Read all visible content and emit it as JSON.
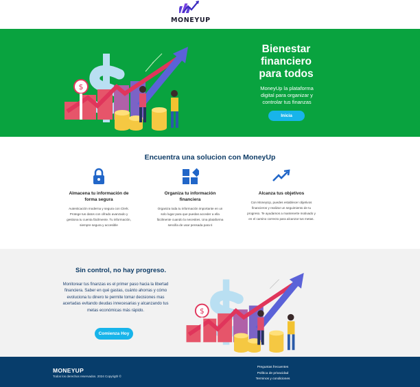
{
  "header": {
    "brand": "MONEYUP",
    "logo_icon": "moneyup-logo-icon"
  },
  "hero": {
    "title": "Bienestar financiero para todos",
    "subtitle": "MoneyUp la plataforma digital para organizar y controlar tus finanzas",
    "cta_label": "Inicia",
    "illustration": "finance-growth-illustration"
  },
  "features": {
    "title": "Encuentra una solucion con MoneyUp",
    "items": [
      {
        "icon": "lock-icon",
        "title": "Almacena tu información de forma segura",
        "text": "Autenticación moderna y segura con Clerk. Protege tus datos con cifrado avanzado y gestiona tu cuenta fácilmente. Tu información, siempre segura y accesible"
      },
      {
        "icon": "widgets-icon",
        "title": "Organiza tu información financiera",
        "text": "Organiza toda tu información importante en un solo lugar para que puedas acceder a ella fácilmente cuando la necesites. Una plataforma sencilla de usar pensada para ti"
      },
      {
        "icon": "trending-up-icon",
        "title": "Alcanza tus objetivos",
        "text": "Con MoneyUp, puedes establecer objetivos financieros y realizar un seguimiento de tu progreso. Te ayudamos a mantenerte motivado y en el camino correcto para alcanzar tus metas."
      }
    ]
  },
  "cta": {
    "title": "Sin control, no hay progreso.",
    "text": "Monitorear tus finanzas es el primer paso hacia la libertad financiera. Saber en qué gastas, cuánto ahorras y cómo evoluciona tu dinero te permite tomar decisiones mas acertadas evitando deudas innecesarias y alcanzando tus metas económicas más rápido.",
    "button_label": "Comienza Hoy"
  },
  "footer": {
    "brand": "MONEYUP",
    "copyright": "Todos los derechos reservados. 2024 Copyrigth ©",
    "links": [
      "Preguntas frecuentes",
      "Política de privacidad",
      "Terminos y condiciones"
    ]
  },
  "colors": {
    "hero_bg": "#09a33f",
    "accent": "#18b4ea",
    "navy": "#0d3b66",
    "footer_bg": "#073d6b"
  }
}
